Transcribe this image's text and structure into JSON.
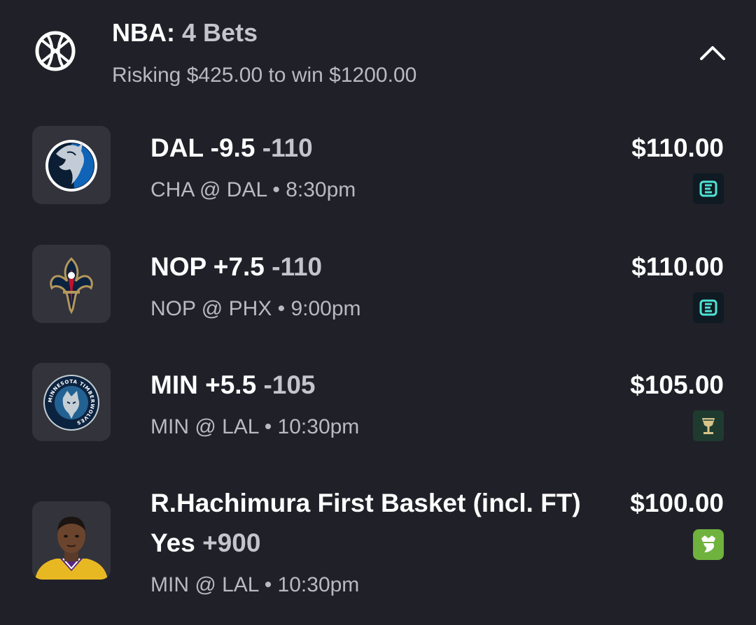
{
  "header": {
    "league": "NBA:",
    "bet_count": "4 Bets",
    "summary": "Risking $425.00 to win $1200.00",
    "sport_icon": "basketball-icon",
    "collapse_icon": "chevron-up-icon"
  },
  "bets": [
    {
      "selection": "DAL -9.5",
      "odds": "-110",
      "game": "CHA @ DAL • 8:30pm",
      "stake": "$110.00",
      "team_logo": "dallas-mavericks-logo",
      "sportsbook": "espn-bet-icon"
    },
    {
      "selection": "NOP +7.5",
      "odds": "-110",
      "game": "NOP @ PHX • 9:00pm",
      "stake": "$110.00",
      "team_logo": "new-orleans-pelicans-logo",
      "sportsbook": "espn-bet-icon"
    },
    {
      "selection": "MIN +5.5",
      "odds": "-105",
      "game": "MIN @ LAL • 10:30pm",
      "stake": "$105.00",
      "team_logo": "minnesota-timberwolves-logo",
      "logo_text": "MINNESOTA TIMBERWOLVES",
      "sportsbook": "goblet-sportsbook-icon"
    },
    {
      "selection_line1": "R.Hachimura First Basket (incl. FT)",
      "selection_line2": "Yes",
      "odds": "+900",
      "game": "MIN @ LAL • 10:30pm",
      "stake": "$100.00",
      "team_logo": "player-headshot",
      "sportsbook": "draftkings-icon"
    }
  ],
  "colors": {
    "background": "#202128",
    "tile": "#32333b",
    "muted_text": "#b9bac1",
    "espn_bet": "#0f1a22",
    "draftkings": "#6fb23e"
  }
}
